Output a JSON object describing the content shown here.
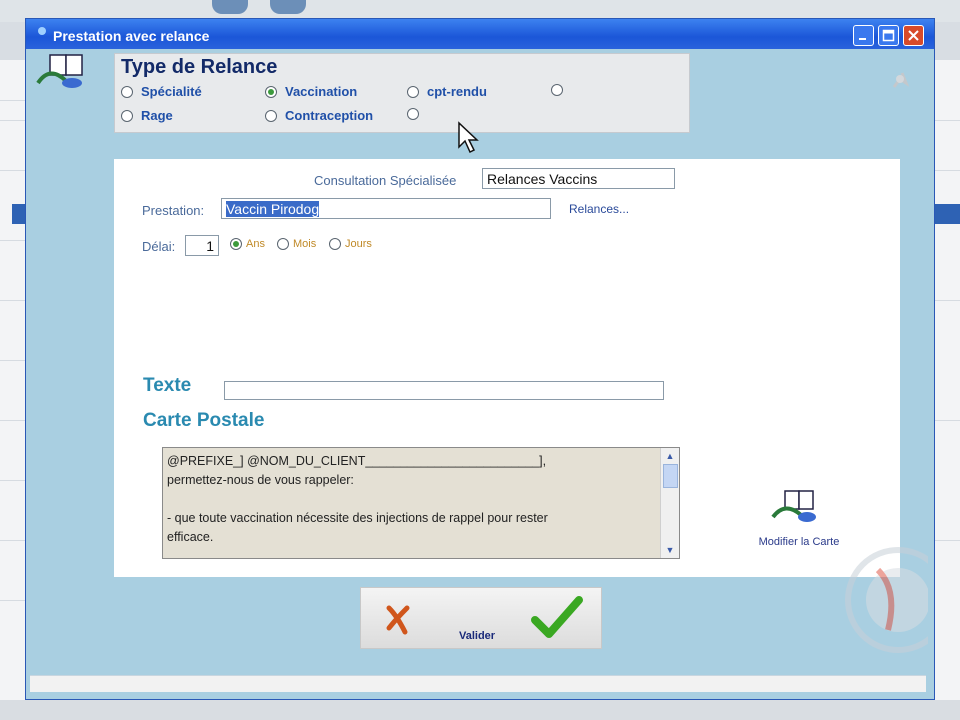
{
  "window": {
    "title": "Prestation avec relance",
    "title_icon": "app-icon",
    "controls": [
      "minimize-icon",
      "maximize-icon",
      "close-icon"
    ]
  },
  "type_relance": {
    "title": "Type de Relance",
    "options": [
      {
        "label": "Spécialité",
        "selected": false
      },
      {
        "label": "Vaccination",
        "selected": true
      },
      {
        "label": "cpt-rendu",
        "selected": false
      },
      {
        "label": "",
        "selected": false
      },
      {
        "label": "Rage",
        "selected": false
      },
      {
        "label": "Contraception",
        "selected": false
      },
      {
        "label": "",
        "selected": false
      }
    ]
  },
  "form": {
    "consultation_label": "Consultation Spécialisée",
    "consultation_value": "Relances Vaccins",
    "prestation_label": "Prestation:",
    "prestation_value": "Vaccin Pirodog",
    "relances_link": "Relances...",
    "delai_label": "Délai:",
    "delai_value": "1",
    "delai_units": [
      {
        "label": "Ans",
        "selected": true
      },
      {
        "label": "Mois",
        "selected": false
      },
      {
        "label": "Jours",
        "selected": false
      }
    ],
    "texte_label": "Texte",
    "texte_value": "",
    "carte_label": "Carte Postale",
    "carte_lines": [
      "@PREFIXE_] @NOM_DU_CLIENT_________________________],",
      "permettez-nous de vous rappeler:",
      "",
      "- que toute vaccination nécessite des injections de rappel pour rester",
      "efficace."
    ],
    "modifier_label": "Modifier la Carte"
  },
  "actions": {
    "valider_label": "Valider"
  },
  "colors": {
    "titlebar": "#1b56d8",
    "window_bg": "#a9cfe1",
    "heading": "#2a8ab0",
    "type_title": "#132a68"
  }
}
